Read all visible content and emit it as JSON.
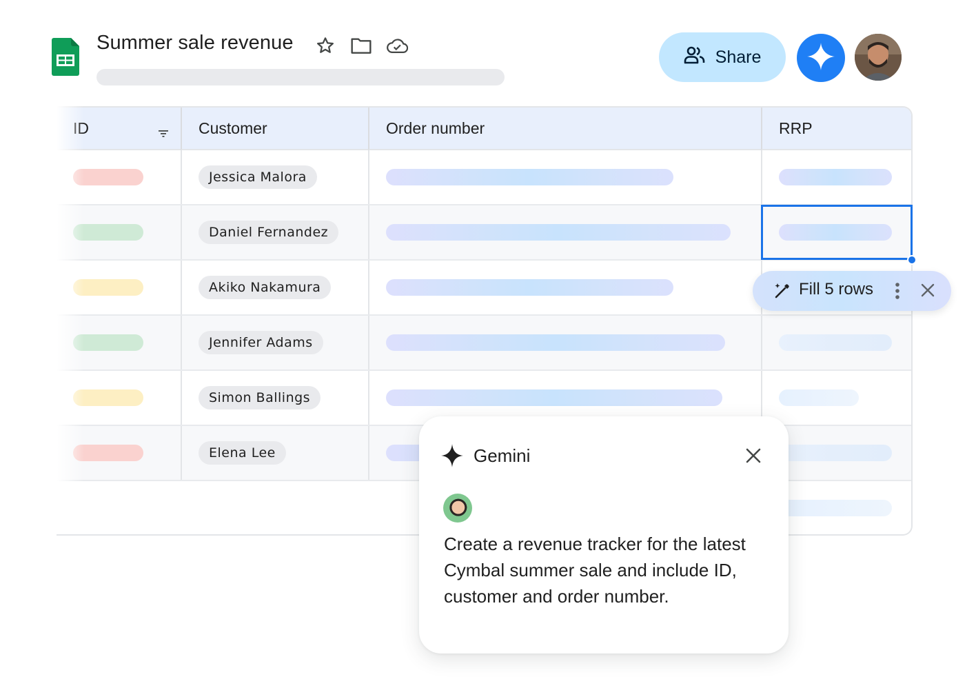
{
  "document": {
    "title": "Summer sale revenue",
    "icons": [
      "star-icon",
      "folder-icon",
      "cloud-saved-icon"
    ]
  },
  "header": {
    "share_label": "Share",
    "share_icon": "people-icon",
    "gemini_button_icon": "gemini-sparkle-icon",
    "avatar": "user-avatar"
  },
  "table": {
    "columns": [
      {
        "label": "ID",
        "has_filter": true
      },
      {
        "label": "Customer"
      },
      {
        "label": "Order number"
      },
      {
        "label": "RRP"
      }
    ],
    "rows": [
      {
        "id_color": "#fad2cf",
        "customer": "Jessica Malora"
      },
      {
        "id_color": "#cfead6",
        "customer": "Daniel Fernandez"
      },
      {
        "id_color": "#fdefc3",
        "customer": "Akiko Nakamura"
      },
      {
        "id_color": "#cfead6",
        "customer": "Jennifer Adams"
      },
      {
        "id_color": "#fdefc3",
        "customer": "Simon Ballings"
      },
      {
        "id_color": "#fad2cf",
        "customer": "Elena Lee"
      }
    ]
  },
  "fill_suggestion": {
    "label": "Fill 5 rows",
    "icon": "magic-wand-icon"
  },
  "gemini_panel": {
    "title": "Gemini",
    "prompt": "Create a revenue tracker for the latest Cymbal summer sale and include ID, customer and order number."
  },
  "colors": {
    "accent": "#1a73e8",
    "share_bg": "#c2e7ff",
    "gemini_button": "#1f7ff5",
    "sheets_green": "#0f9d58"
  }
}
